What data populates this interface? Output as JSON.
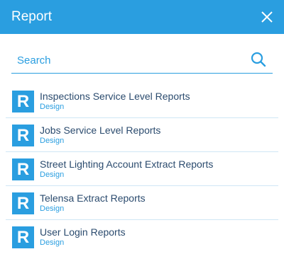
{
  "header": {
    "title": "Report"
  },
  "search": {
    "placeholder": "Search",
    "value": ""
  },
  "reports": [
    {
      "title": "Inspections Service Level Reports",
      "subtitle": "Design",
      "icon_letter": "R"
    },
    {
      "title": "Jobs Service Level Reports",
      "subtitle": "Design",
      "icon_letter": "R"
    },
    {
      "title": "Street Lighting Account Extract Reports",
      "subtitle": "Design",
      "icon_letter": "R"
    },
    {
      "title": "Telensa Extract Reports",
      "subtitle": "Design",
      "icon_letter": "R"
    },
    {
      "title": "User Login Reports",
      "subtitle": "Design",
      "icon_letter": "R"
    }
  ],
  "colors": {
    "accent": "#2a9ee0",
    "title_text": "#2b4b6e",
    "divider": "#cfe6f5"
  }
}
